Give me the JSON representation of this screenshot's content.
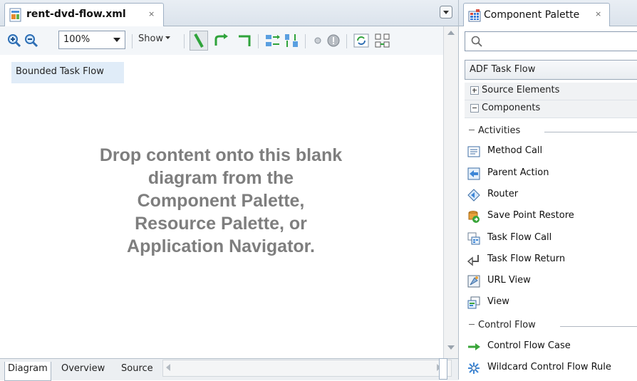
{
  "editor": {
    "tab_title": "rent-dvd-flow.xml",
    "tab_close": "×",
    "toolbar": {
      "zoom_value": "100%",
      "show_label": "Show"
    },
    "canvas_label": "Bounded Task Flow",
    "placeholder_lines": [
      "Drop content onto this blank",
      "diagram from the",
      "Component Palette,",
      "Resource Palette, or",
      "Application Navigator."
    ],
    "bottom_tabs": [
      "Diagram",
      "Overview",
      "Source"
    ]
  },
  "palette": {
    "tab_title": "Component Palette",
    "tab_close": "×",
    "search_placeholder": "",
    "selected_page": "ADF Task Flow",
    "sections": [
      {
        "label": "Source Elements",
        "expanded": false
      },
      {
        "label": "Components",
        "expanded": true
      }
    ],
    "groups": [
      {
        "title": "Activities",
        "items": [
          {
            "label": "Method Call",
            "icon": "method-call-icon"
          },
          {
            "label": "Parent Action",
            "icon": "parent-action-icon"
          },
          {
            "label": "Router",
            "icon": "router-icon"
          },
          {
            "label": "Save Point Restore",
            "icon": "save-point-restore-icon"
          },
          {
            "label": "Task Flow Call",
            "icon": "task-flow-call-icon"
          },
          {
            "label": "Task Flow Return",
            "icon": "task-flow-return-icon"
          },
          {
            "label": "URL View",
            "icon": "url-view-icon"
          },
          {
            "label": "View",
            "icon": "view-icon"
          }
        ]
      },
      {
        "title": "Control Flow",
        "items": [
          {
            "label": "Control Flow Case",
            "icon": "control-flow-case-icon"
          },
          {
            "label": "Wildcard Control Flow Rule",
            "icon": "wildcard-control-flow-rule-icon"
          }
        ]
      }
    ]
  },
  "colors": {
    "accent": "#2f6fb3",
    "selection": "#e0ecf8",
    "placeholder_text": "#7e7e7e",
    "control_flow_green": "#3aa53a"
  }
}
